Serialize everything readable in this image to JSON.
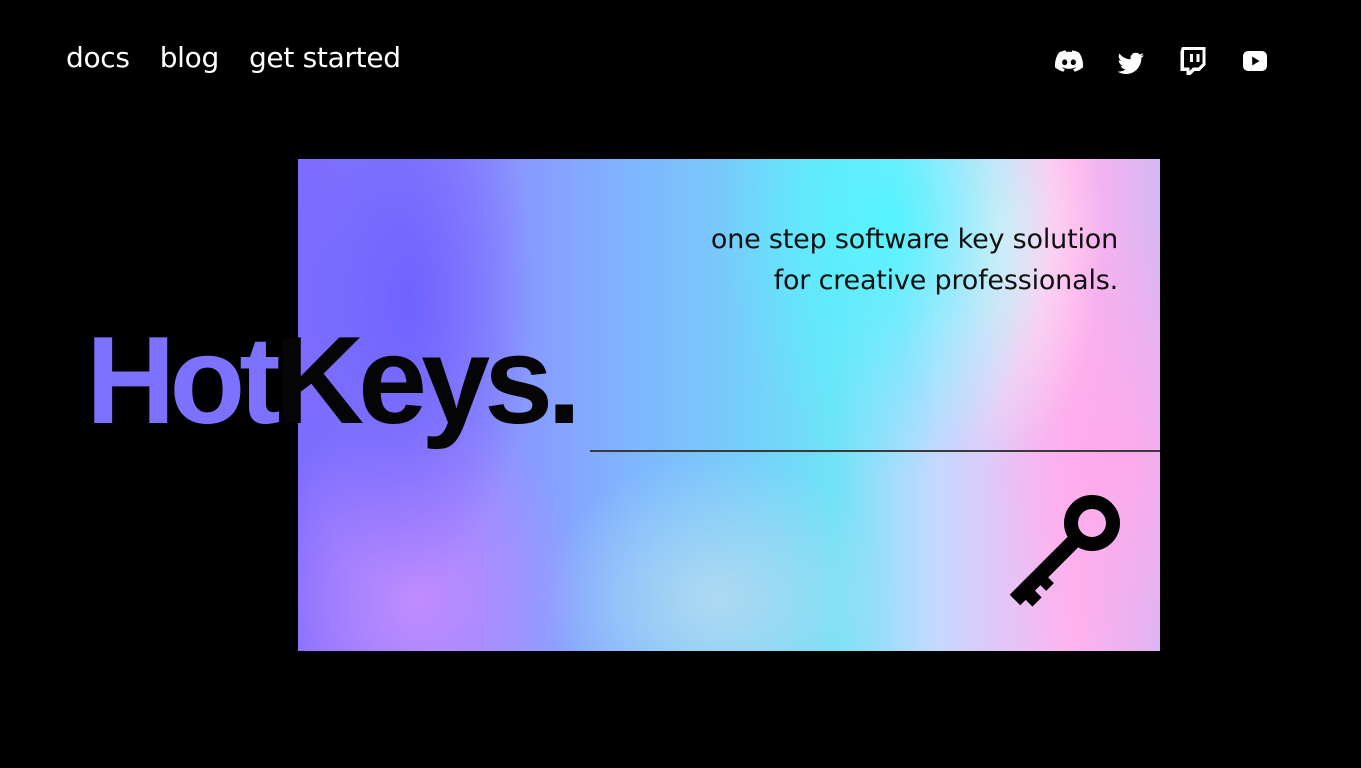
{
  "nav": {
    "links": [
      {
        "label": "docs"
      },
      {
        "label": "blog"
      },
      {
        "label": "get started"
      }
    ]
  },
  "social": {
    "icons": [
      {
        "name": "discord-icon"
      },
      {
        "name": "twitter-icon"
      },
      {
        "name": "twitch-icon"
      },
      {
        "name": "youtube-icon"
      }
    ]
  },
  "hero": {
    "logo_part1": "Hot",
    "logo_part2": "Keys.",
    "tagline_line1": "one step software key solution",
    "tagline_line2": "for creative professionals.",
    "icon": "key-icon"
  },
  "colors": {
    "background": "#000000",
    "brand_purple": "#7c72ff",
    "text_light": "#ffffff",
    "text_dark": "#050505"
  }
}
